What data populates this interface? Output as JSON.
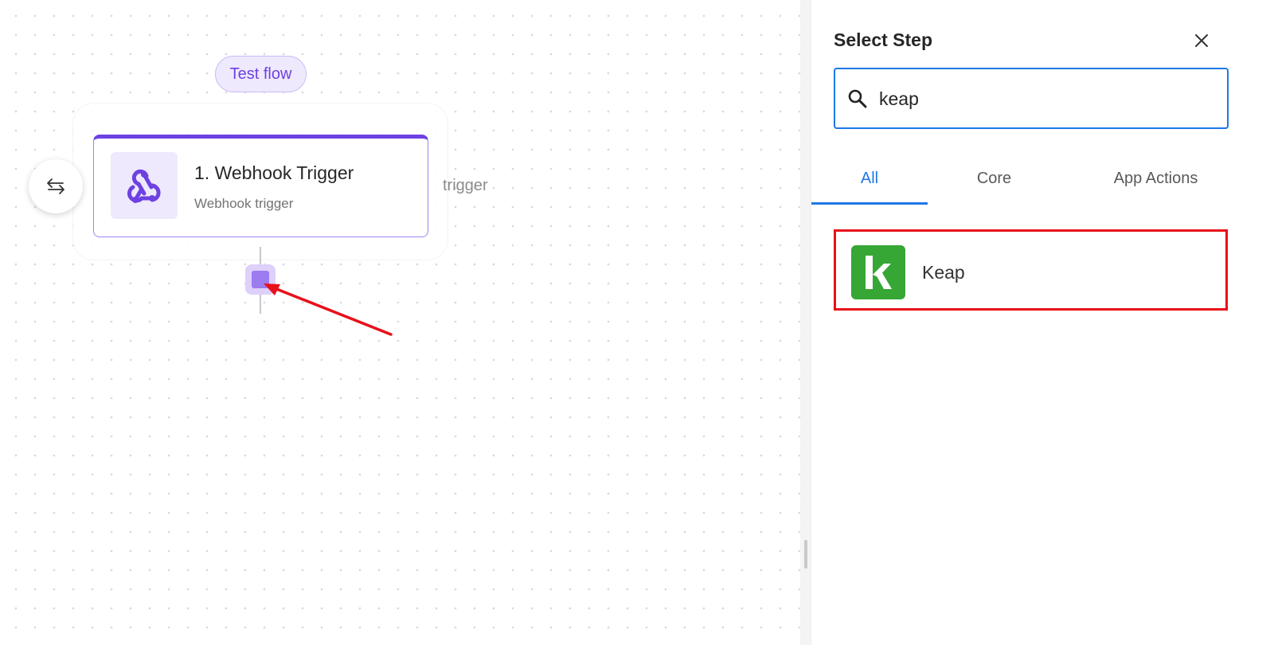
{
  "canvas": {
    "test_flow_label": "Test flow",
    "trigger_step": {
      "title": "1. Webhook Trigger",
      "subtitle": "Webhook trigger",
      "icon": "webhook-icon"
    },
    "side_label": "trigger",
    "swap_icon": "swap-arrows-icon",
    "add_step_handle_icon": "add-step-icon"
  },
  "panel": {
    "title": "Select Step",
    "close_icon": "close-icon",
    "search": {
      "value": "keap",
      "icon": "search-icon"
    },
    "tabs": [
      {
        "label": "All",
        "active": true
      },
      {
        "label": "Core",
        "active": false
      },
      {
        "label": "App Actions",
        "active": false
      }
    ],
    "results": [
      {
        "label": "Keap",
        "icon": "keap-logo",
        "highlighted": true
      }
    ]
  },
  "colors": {
    "accent_purple": "#6e41e2",
    "accent_blue": "#1e78e6",
    "keap_green": "#36a635",
    "annotation_red": "#e8101a"
  }
}
